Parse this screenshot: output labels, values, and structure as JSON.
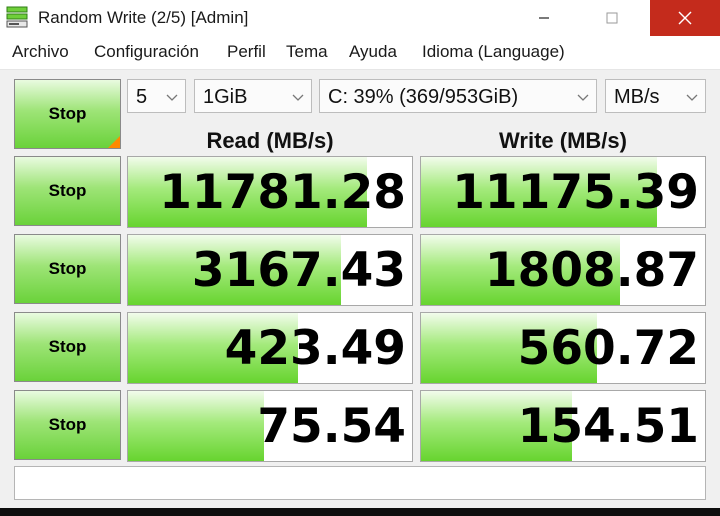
{
  "window": {
    "title": "Random Write (2/5) [Admin]",
    "icon": "crystaldiskmark-app-icon"
  },
  "menu": {
    "items": [
      "Archivo",
      "Configuración",
      "Perfil",
      "Tema",
      "Ayuda",
      "Idioma (Language)"
    ]
  },
  "controls": {
    "count": "5",
    "size": "1GiB",
    "drive": "C: 39% (369/953GiB)",
    "unit": "MB/s"
  },
  "headers": {
    "read": "Read (MB/s)",
    "write": "Write (MB/s)"
  },
  "rows": [
    {
      "button": "Stop",
      "read": "11781.28",
      "write": "11175.39",
      "read_fill_pct": 84,
      "write_fill_pct": 83
    },
    {
      "button": "Stop",
      "read": "3167.43",
      "write": "1808.87",
      "read_fill_pct": 75,
      "write_fill_pct": 70
    },
    {
      "button": "Stop",
      "read": "423.49",
      "write": "560.72",
      "read_fill_pct": 60,
      "write_fill_pct": 62
    },
    {
      "button": "Stop",
      "read": "75.54",
      "write": "154.51",
      "read_fill_pct": 48,
      "write_fill_pct": 53
    }
  ],
  "all_button": "Stop",
  "status": "",
  "colors": {
    "close_button": "#c42b1c",
    "bar_green": "#67d42f",
    "corner_orange": "#ff8a00"
  }
}
